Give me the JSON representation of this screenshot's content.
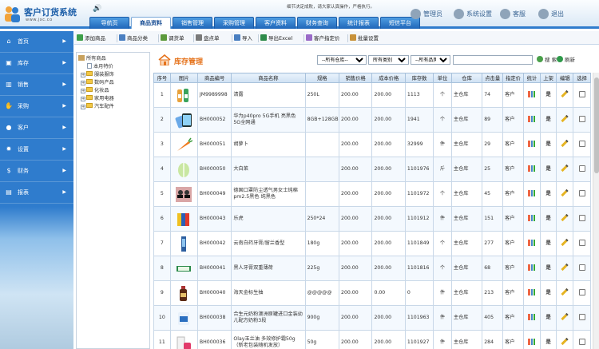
{
  "app": {
    "title": "客户订货系统",
    "subtitle": "www.jxc.co",
    "notice": [
      "细节决定成败，请大家认真操作，严格执行。"
    ]
  },
  "top_nav": [
    {
      "label": "导航页",
      "active": false
    },
    {
      "label": "商品资料",
      "active": true
    },
    {
      "label": "销售管理",
      "active": false
    },
    {
      "label": "采购管理",
      "active": false
    },
    {
      "label": "客户资料",
      "active": false
    },
    {
      "label": "财务查询",
      "active": false
    },
    {
      "label": "统计报表",
      "active": false
    },
    {
      "label": "短信平台",
      "active": false
    }
  ],
  "top_right": [
    {
      "label": "管理员",
      "icon": "user-icon"
    },
    {
      "label": "系统设置",
      "icon": "gear-icon"
    },
    {
      "label": "客服",
      "icon": "headset-icon"
    },
    {
      "label": "退出",
      "icon": "logout-icon"
    }
  ],
  "sidebar": [
    {
      "label": "首页",
      "icon": "home-icon"
    },
    {
      "label": "库存",
      "icon": "cart-icon"
    },
    {
      "label": "销售",
      "icon": "chart-icon"
    },
    {
      "label": "采购",
      "icon": "handshake-icon"
    },
    {
      "label": "客户",
      "icon": "person-icon"
    },
    {
      "label": "设置",
      "icon": "gear-icon"
    },
    {
      "label": "财务",
      "icon": "dollar-icon"
    },
    {
      "label": "报表",
      "icon": "report-icon"
    }
  ],
  "toolbar": [
    {
      "label": "添加商品",
      "color": "#3ea04a"
    },
    {
      "label": "商品分类",
      "color": "#4a7fc1"
    },
    {
      "label": "调货单",
      "color": "#5c9a3c"
    },
    {
      "label": "盘点单",
      "color": "#7a7a7a"
    },
    {
      "label": "导入",
      "color": "#4a7fc1"
    },
    {
      "label": "导出Excel",
      "color": "#2e8b4a"
    },
    {
      "label": "客户指定价",
      "color": "#9a6ac8"
    },
    {
      "label": "批量设置",
      "color": "#c8923a"
    }
  ],
  "tree": {
    "root": "所有商品",
    "items": [
      {
        "label": "本月特价",
        "type": "doc",
        "expander": ""
      },
      {
        "label": "服装服饰",
        "type": "folder",
        "expander": "+"
      },
      {
        "label": "数码产品",
        "type": "folder",
        "expander": "+"
      },
      {
        "label": "化妆品",
        "type": "folder",
        "expander": "+"
      },
      {
        "label": "家用电器",
        "type": "folder",
        "expander": "+"
      },
      {
        "label": "汽车配件",
        "type": "folder",
        "expander": "+"
      }
    ]
  },
  "content": {
    "title": "库存管理",
    "filters": [
      {
        "selected": "--所有仓库--"
      },
      {
        "selected": "所有类别"
      },
      {
        "selected": "--所有品牌--"
      }
    ],
    "search_label": "搜 索",
    "refresh_label": "刷新"
  },
  "table": {
    "headers": [
      "序号",
      "图片",
      "商品编号",
      "商品名称",
      "规格",
      "销售价格",
      "成本价格",
      "库存数",
      "单位",
      "仓库",
      "点击量",
      "指定价",
      "统计",
      "上架",
      "编辑",
      "选择"
    ],
    "rows": [
      {
        "no": "1",
        "img": "bottles",
        "code": "JM9989998",
        "name": "清露",
        "spec": "250L",
        "price": "200.00",
        "cost": "200.00",
        "stock": "1113",
        "unit": "个",
        "warehouse": "主仓库",
        "clicks": "74",
        "assigned": "客户",
        "up": "是"
      },
      {
        "no": "2",
        "img": "phone",
        "code": "BH000052",
        "name": "华为p40pro 5G手机 亮黑色 5G全网通",
        "spec": "8GB+128GB",
        "price": "200.00",
        "cost": "200.00",
        "stock": "1941",
        "unit": "个",
        "warehouse": "主仓库",
        "clicks": "89",
        "assigned": "客户",
        "up": "是"
      },
      {
        "no": "3",
        "img": "carrot",
        "code": "BH000051",
        "name": "胡萝卜",
        "spec": "",
        "price": "200.00",
        "cost": "200.00",
        "stock": "32999",
        "unit": "件",
        "warehouse": "主仓库",
        "clicks": "29",
        "assigned": "客户",
        "up": "是"
      },
      {
        "no": "4",
        "img": "cabbage",
        "code": "BH000050",
        "name": "大白菜",
        "spec": "",
        "price": "200.00",
        "cost": "200.00",
        "stock": "1101976",
        "unit": "斤",
        "warehouse": "主仓库",
        "clicks": "25",
        "assigned": "客户",
        "up": "是"
      },
      {
        "no": "5",
        "img": "mask",
        "code": "BH000049",
        "name": "德国口罩防尘透气男女士纯棉pm2.5黑色 纯黑色",
        "spec": "",
        "price": "200.00",
        "cost": "200.00",
        "stock": "1101972",
        "unit": "个",
        "warehouse": "主仓库",
        "clicks": "45",
        "assigned": "客户",
        "up": "是"
      },
      {
        "no": "6",
        "img": "cans",
        "code": "BH000043",
        "name": "乐虎",
        "spec": "250*24",
        "price": "200.00",
        "cost": "200.00",
        "stock": "1101912",
        "unit": "件",
        "warehouse": "主仓库",
        "clicks": "151",
        "assigned": "客户",
        "up": "是"
      },
      {
        "no": "7",
        "img": "toothpaste",
        "code": "BH000042",
        "name": "云南白药牙膏/留兰香型",
        "spec": "180g",
        "price": "200.00",
        "cost": "200.00",
        "stock": "1101849",
        "unit": "个",
        "warehouse": "主仓库",
        "clicks": "277",
        "assigned": "客户",
        "up": "是"
      },
      {
        "no": "8",
        "img": "toothpaste2",
        "code": "BH000041",
        "name": "黑人牙膏双重薄荷",
        "spec": "225g",
        "price": "200.00",
        "cost": "200.00",
        "stock": "1101816",
        "unit": "个",
        "warehouse": "主仓库",
        "clicks": "68",
        "assigned": "客户",
        "up": "是"
      },
      {
        "no": "9",
        "img": "soy",
        "code": "BH000040",
        "name": "海天金标生抽",
        "spec": "@@@@@",
        "price": "200.00",
        "cost": "0.00",
        "stock": "0",
        "unit": "件",
        "warehouse": "主仓库",
        "clicks": "213",
        "assigned": "客户",
        "up": "是"
      },
      {
        "no": "10",
        "img": "milk",
        "code": "BH000038",
        "name": "合生元奶粉澳洲原罐进口金装幼儿配方奶粉3段",
        "spec": "900g",
        "price": "200.00",
        "cost": "200.00",
        "stock": "1101963",
        "unit": "件",
        "warehouse": "主仓库",
        "clicks": "405",
        "assigned": "客户",
        "up": "是"
      },
      {
        "no": "11",
        "img": "olay",
        "code": "BH000036",
        "name": "Olay玉兰油 多效修护霜50g（新老包装随机发放）",
        "spec": "50g",
        "price": "200.00",
        "cost": "200.00",
        "stock": "1101927",
        "unit": "件",
        "warehouse": "主仓库",
        "clicks": "284",
        "assigned": "客户",
        "up": "是"
      }
    ]
  }
}
